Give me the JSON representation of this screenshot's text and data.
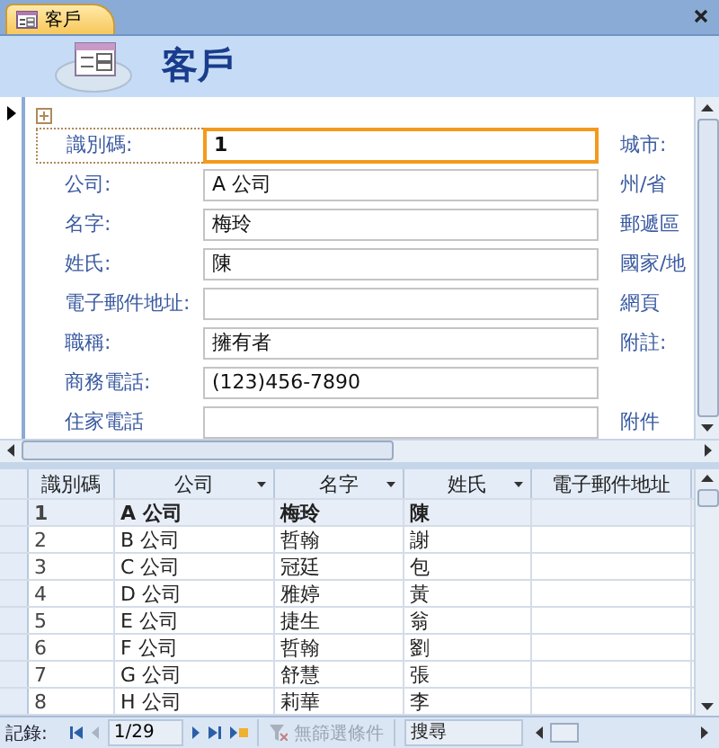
{
  "document_tab": {
    "label": "客戶"
  },
  "header": {
    "title": "客戶"
  },
  "form": {
    "fields": [
      {
        "label": "識別碼:",
        "value": "1",
        "focused": true,
        "right_label": "城市:"
      },
      {
        "label": "公司:",
        "value": "A 公司",
        "focused": false,
        "right_label": "州/省"
      },
      {
        "label": "名字:",
        "value": "梅玲",
        "focused": false,
        "right_label": "郵遞區"
      },
      {
        "label": "姓氏:",
        "value": "陳",
        "focused": false,
        "right_label": "國家/地"
      },
      {
        "label": "電子郵件地址:",
        "focused": false,
        "right_label": "網頁"
      },
      {
        "label": "職稱:",
        "value": "擁有者",
        "focused": false,
        "right_label": "附註:"
      },
      {
        "label": "商務電話:",
        "value": "(123)456-7890",
        "focused": false
      },
      {
        "label": "住家電話",
        "focused": false,
        "right_label": "附件"
      }
    ]
  },
  "datasheet": {
    "columns": [
      {
        "label": "識別碼",
        "dropdown": false
      },
      {
        "label": "公司",
        "dropdown": true
      },
      {
        "label": "名字",
        "dropdown": true
      },
      {
        "label": "姓氏",
        "dropdown": true
      },
      {
        "label": "電子郵件地址",
        "dropdown": false
      }
    ],
    "rows": [
      {
        "cells": [
          "1",
          "A 公司",
          "梅玲",
          "陳",
          null
        ],
        "selected": true
      },
      {
        "cells": [
          "2",
          "B 公司",
          "哲翰",
          "謝",
          null
        ],
        "selected": false
      },
      {
        "cells": [
          "3",
          "C 公司",
          "冠廷",
          "包",
          null
        ],
        "selected": false
      },
      {
        "cells": [
          "4",
          "D 公司",
          "雅婷",
          "黃",
          null
        ],
        "selected": false
      },
      {
        "cells": [
          "5",
          "E 公司",
          "捷生",
          "翁",
          null
        ],
        "selected": false
      },
      {
        "cells": [
          "6",
          "F 公司",
          "哲翰",
          "劉",
          null
        ],
        "selected": false
      },
      {
        "cells": [
          "7",
          "G 公司",
          "舒慧",
          "張",
          null
        ],
        "selected": false
      },
      {
        "cells": [
          "8",
          "H 公司",
          "莉華",
          "李",
          null
        ],
        "selected": false
      }
    ]
  },
  "navigation": {
    "label": "記錄:",
    "position": "1/29",
    "filter": "無篩選條件",
    "filter_disabled": true,
    "search_placeholder": "搜尋"
  }
}
